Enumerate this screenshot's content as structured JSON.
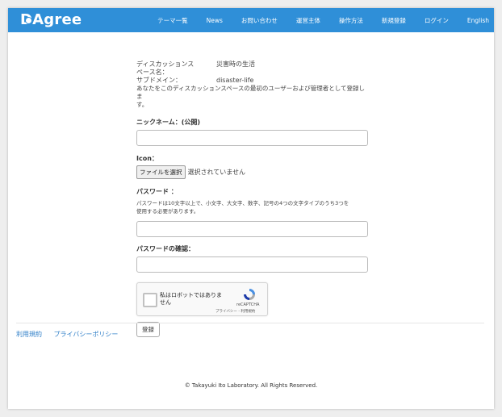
{
  "header": {
    "logo": "DAgree",
    "nav": [
      "テーマ一覧",
      "News",
      "お問い合わせ",
      "運営主体",
      "操作方法",
      "新規登録",
      "ログイン",
      "English"
    ]
  },
  "form": {
    "space_name_label": "ディスカッションス",
    "space_name_label2": "ペース名：",
    "space_name_value": "災害時の生活",
    "subdomain_label": "サブドメイン：",
    "subdomain_value": "disaster-life",
    "notice_line1": "あなたをこのディスカッションスペースの最初のユーザーおよび管理者として登録しま",
    "notice_line2": "す。",
    "nickname_label": "ニックネーム：(公開)",
    "nickname_value": "",
    "icon_label": "Icon：",
    "file_button": "ファイルを選択",
    "file_status": "選択されていません",
    "password_label": "パスワード ：",
    "password_help_line1": "パスワードは10文字以上で、小文字、大文字、数字、記号の4つの文字タイプのうち3つを",
    "password_help_line2": "使用する必要があります。",
    "password_value": "",
    "password_confirm_label": "パスワードの確認：",
    "password_confirm_value": "",
    "captcha_text": "私はロボットではありません",
    "captcha_brand": "reCAPTCHA",
    "captcha_links": "プライバシー - 利用規約",
    "submit": "登録"
  },
  "footer": {
    "links": [
      "利用規約",
      "プライバシーポリシー"
    ],
    "copyright": "© Takayuki Ito Laboratory. All Rights Reserved."
  },
  "colors": {
    "navbar": "#2f8fd8",
    "link": "#2f7fc8"
  }
}
